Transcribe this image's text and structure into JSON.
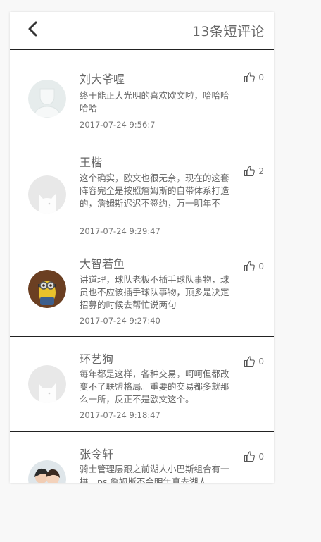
{
  "header": {
    "back_icon": "chevron-left-icon",
    "title": "13条短评论"
  },
  "comments": [
    {
      "author": "刘大爷喔",
      "avatar": "default-silhouette-avatar",
      "content": "终于能正大光明的喜欢欧文啦，哈哈哈哈哈",
      "time": "2017-07-24 9:56:7",
      "likes": "0"
    },
    {
      "author": "王楷",
      "avatar": "default-cat-avatar",
      "content": "这个确实，欧文也很无奈，现在的这套阵容完全是按照詹姆斯的自带体系打造的，詹姆斯迟迟不签约，万一明年不",
      "time": "2017-07-24 9:29:47",
      "likes": "2"
    },
    {
      "author": "大智若鱼",
      "avatar": "minion-photo-avatar",
      "content": "讲道理，球队老板不插手球队事物，球员也不应该插手球队事物，顶多是决定招募的时候去帮忙说两句",
      "time": "2017-07-24 9:27:40",
      "likes": "0"
    },
    {
      "author": "环艺狗",
      "avatar": "default-cat-avatar",
      "content": "每年都是这样，各种交易，呵呵但都改变不了联盟格局。重要的交易都多就那么一所，反正不是欧文这个。",
      "time": "2017-07-24 9:18:47",
      "likes": "0"
    },
    {
      "author": "张令轩",
      "avatar": "couple-photo-avatar",
      "content": "骑士管理层跟之前湖人小巴斯组合有一拼，ps.詹姆斯不会明年真去湖人",
      "time": "",
      "likes": "0"
    }
  ]
}
